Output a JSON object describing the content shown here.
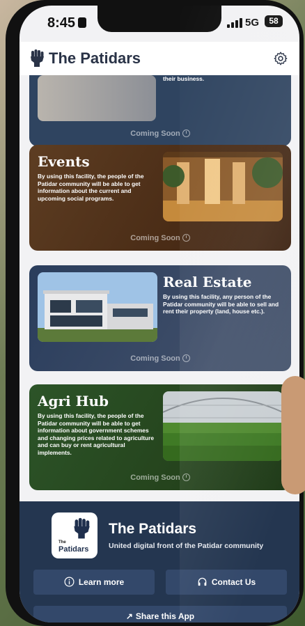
{
  "status_bar": {
    "time": "8:45",
    "network": "5G",
    "battery": "58"
  },
  "app": {
    "title": "The Patidars"
  },
  "cards": {
    "top": {
      "desc": "their business.",
      "status": "Coming Soon"
    },
    "events": {
      "title": "Events",
      "desc": "By using this facility, the people of the Patidar community will be able to get information about the current and upcoming social programs.",
      "status": "Coming Soon"
    },
    "real_estate": {
      "title": "Real Estate",
      "desc": "By using this facility, any person of the Patidar community will be able to sell and rent their property (land, house etc.).",
      "status": "Coming Soon"
    },
    "agri_hub": {
      "title": "Agri Hub",
      "desc": "By using this facility, the people of the Patidar community will be able to get information about government schemes and changing prices related to agriculture and can buy or rent agricultural implements.",
      "status": "Coming Soon"
    }
  },
  "footer": {
    "logo_small": "The",
    "logo_name": "Patidars",
    "title": "The Patidars",
    "subtitle": "United digital front of the Patidar community",
    "learn_more": "Learn more",
    "contact_us": "Contact Us",
    "share": "Share this App"
  },
  "icons": [
    "fist-logo-icon",
    "gear-icon",
    "clock-icon",
    "info-icon",
    "headphones-icon",
    "share-icon"
  ]
}
